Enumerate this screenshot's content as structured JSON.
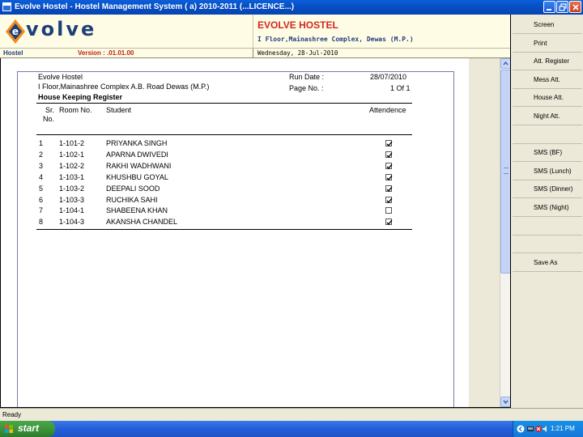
{
  "window": {
    "title": "Evolve Hostel - Hostel Management System ( a) 2010-2011 (...LICENCE...)"
  },
  "header": {
    "logo_text": "volve",
    "hostel_name": "EVOLVE HOSTEL",
    "hostel_address": "I Floor,Mainashree Complex, Dewas (M.P.)",
    "module": "Hostel",
    "version": "Version : .01.01.00",
    "date": "Wednesday, 28-Jul-2010"
  },
  "report": {
    "org_name": "Evolve Hostel",
    "org_address": "I Floor,Mainashree Complex A.B. Road Dewas (M.P.)",
    "title": "House Keeping Register",
    "run_date_label": "Run Date :",
    "run_date": "28/07/2010",
    "page_label": "Page No. :",
    "page_value": "1 Of 1",
    "columns": {
      "sr_line1": "Sr.",
      "sr_line2": "No.",
      "room": "Room No.",
      "student": "Student",
      "attendance": "Attendence"
    },
    "rows": [
      {
        "sr": "1",
        "room": "1-101-2",
        "student": "PRIYANKA SINGH",
        "present": true
      },
      {
        "sr": "2",
        "room": "1-102-1",
        "student": "APARNA  DWIVEDI",
        "present": true
      },
      {
        "sr": "3",
        "room": "1-102-2",
        "student": "RAKHI WADHWANI",
        "present": true
      },
      {
        "sr": "4",
        "room": "1-103-1",
        "student": "KHUSHBU  GOYAL",
        "present": true
      },
      {
        "sr": "5",
        "room": "1-103-2",
        "student": "DEEPALI  SOOD",
        "present": true
      },
      {
        "sr": "6",
        "room": "1-103-3",
        "student": "RUCHIKA  SAHI",
        "present": true
      },
      {
        "sr": "7",
        "room": "1-104-1",
        "student": "SHABEENA KHAN",
        "present": false
      },
      {
        "sr": "8",
        "room": "1-104-3",
        "student": "AKANSHA CHANDEL",
        "present": true
      }
    ]
  },
  "sidebar": {
    "items": [
      {
        "label": "Screen"
      },
      {
        "label": "Print"
      },
      {
        "label": "Att. Register"
      },
      {
        "label": "Mess Att."
      },
      {
        "label": "House Att."
      },
      {
        "label": "Night Att."
      },
      {
        "label": ""
      },
      {
        "label": "SMS (BF)"
      },
      {
        "label": "SMS (Lunch)"
      },
      {
        "label": "SMS (Dinner)"
      },
      {
        "label": "SMS (Night)"
      },
      {
        "label": ""
      },
      {
        "label": ""
      },
      {
        "label": "Save As"
      }
    ]
  },
  "status": {
    "text": "Ready"
  },
  "taskbar": {
    "start_label": "start",
    "clock": "1:21 PM"
  },
  "colors": {
    "brand_red": "#d0281c",
    "brand_blue": "#1f3f7a",
    "taskbar_blue": "#245ed8",
    "start_green": "#3a9038"
  }
}
